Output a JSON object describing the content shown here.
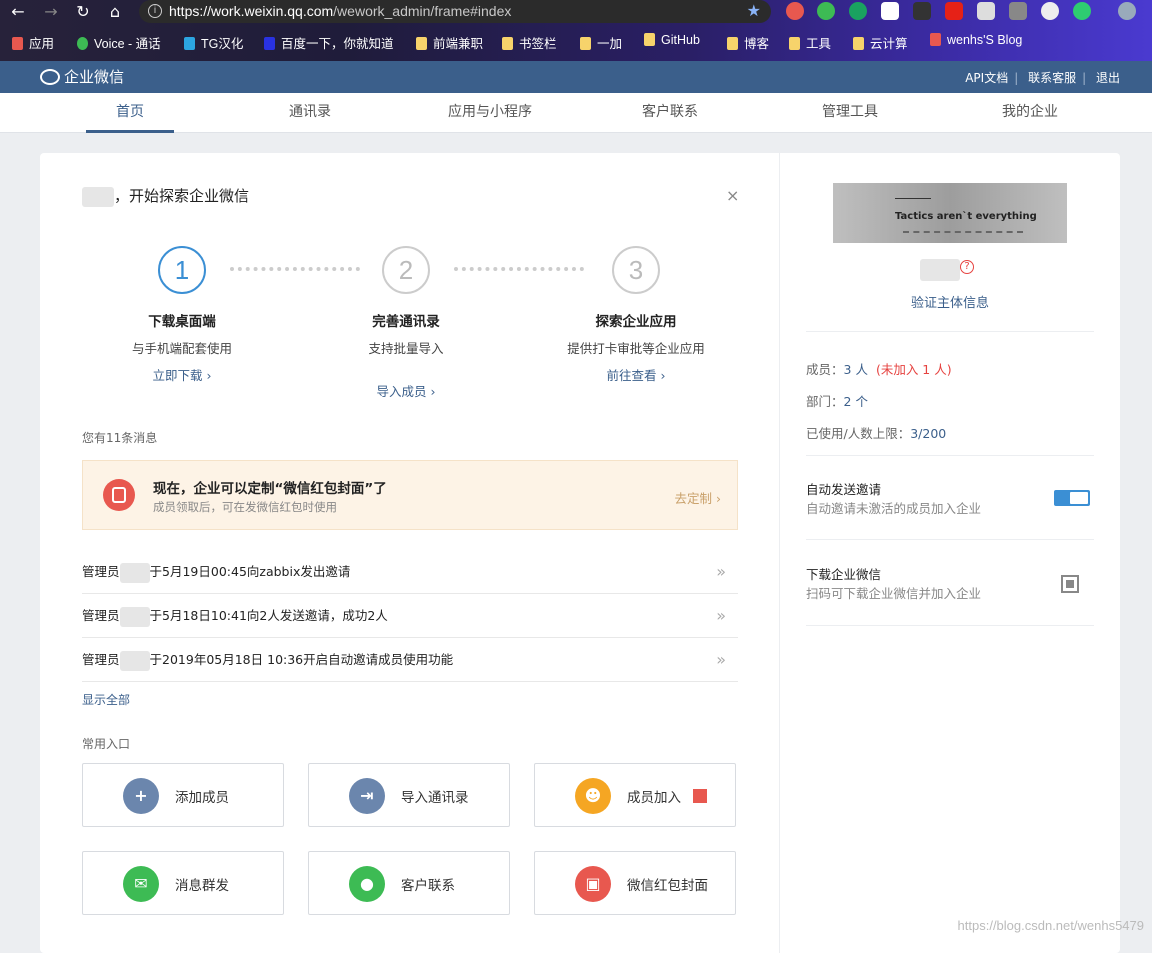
{
  "browser": {
    "url_host": "https://work.weixin.qq.com",
    "url_path": "/wework_admin/frame#index",
    "bookmarks": [
      "应用",
      "Voice - 通话",
      "TG汉化",
      "百度一下，你就知道",
      "前端兼职",
      "书签栏",
      "一加",
      "GitHub",
      "博客",
      "工具",
      "云计算",
      "wenhs'S Blog"
    ]
  },
  "topbar": {
    "logo": "企业微信",
    "links": [
      "API文档",
      "联系客服",
      "退出"
    ]
  },
  "nav": {
    "tabs": [
      "首页",
      "通讯录",
      "应用与小程序",
      "客户联系",
      "管理工具",
      "我的企业"
    ],
    "active_index": 0
  },
  "main": {
    "greeting": "，开始探索企业微信",
    "steps": [
      {
        "num": "1",
        "title": "下载桌面端",
        "desc": "与手机端配套使用",
        "link": "立即下载 ›"
      },
      {
        "num": "2",
        "title": "完善通讯录",
        "desc": "支持批量导入",
        "link": "导入成员 ›"
      },
      {
        "num": "3",
        "title": "探索企业应用",
        "desc": "提供打卡审批等企业应用",
        "link": "前往查看 ›"
      }
    ],
    "msg_count": "您有11条消息",
    "banner": {
      "title": "现在，企业可以定制“微信红包封面”了",
      "sub": "成员领取后，可在发微信红包时使用",
      "action": "去定制 ›"
    },
    "messages": [
      {
        "prefix": "管理员",
        "text": "于5月19日00:45向zabbix发出邀请"
      },
      {
        "prefix": "管理员",
        "text": "于5月18日10:41向2人发送邀请，成功2人"
      },
      {
        "prefix": "管理员",
        "text": "于2019年05月18日 10:36开启自动邀请成员使用功能"
      }
    ],
    "show_all": "显示全部",
    "quick_title": "常用入口",
    "quick": [
      {
        "label": "添加成员",
        "icon": "add-member-icon",
        "color": "#6b86ad"
      },
      {
        "label": "导入通讯录",
        "icon": "import-icon",
        "color": "#6b86ad"
      },
      {
        "label": "成员加入",
        "icon": "members-icon",
        "color": "#f5a623"
      },
      {
        "label": "消息群发",
        "icon": "broadcast-icon",
        "color": "#3dbb54"
      },
      {
        "label": "客户联系",
        "icon": "wechat-icon",
        "color": "#3dbb54"
      },
      {
        "label": "微信红包封面",
        "icon": "red-packet-icon",
        "color": "#e8584f"
      }
    ]
  },
  "side": {
    "corp_text": "Tactics aren`t everything",
    "verify": "验证主体信息",
    "stats": {
      "members_label": "成员：",
      "members_value": "3 人",
      "members_pending": "(未加入 1 人)",
      "dept_label": "部门：",
      "dept_value": "2 个",
      "limit_label": "已使用/人数上限：",
      "limit_value": "3/200"
    },
    "auto_invite": {
      "title": "自动发送邀请",
      "sub": "自动邀请未激活的成员加入企业",
      "enabled": true
    },
    "download": {
      "title": "下载企业微信",
      "sub": "扫码可下载企业微信并加入企业"
    }
  },
  "watermark": "https://blog.csdn.net/wenhs5479"
}
